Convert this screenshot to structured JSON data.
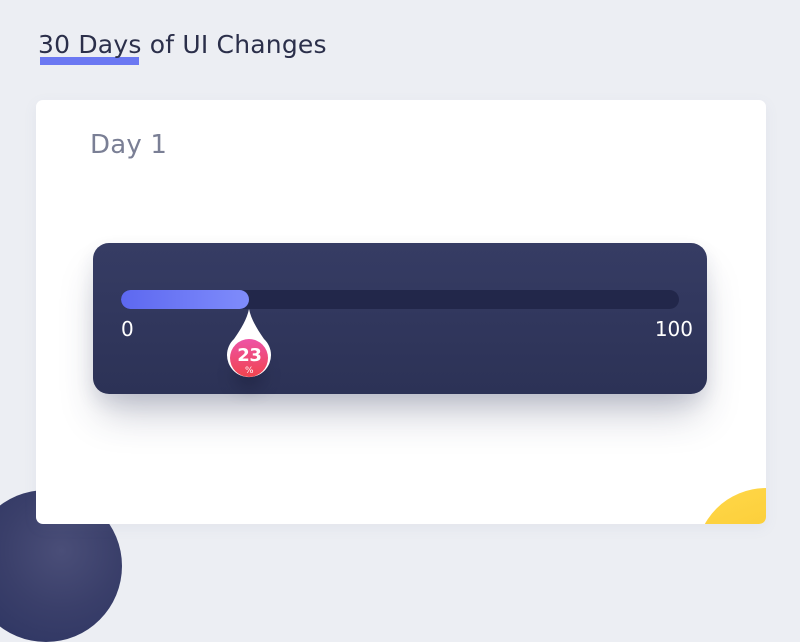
{
  "page": {
    "title": "30 Days of UI Changes"
  },
  "card": {
    "day_label": "Day 1"
  },
  "slider": {
    "value": 23,
    "unit": "%",
    "min": 0,
    "max": 100,
    "min_label": "0",
    "max_label": "100",
    "value_label": "23"
  },
  "colors": {
    "background": "#eceef3",
    "card": "#ffffff",
    "panel": "#323860",
    "track": "#22274a",
    "fill_start": "#5d68f0",
    "fill_end": "#7f8cfb",
    "thumb_top": "#ee53a6",
    "thumb_bottom": "#f0444e",
    "accent_yellow": "#f6bd1c",
    "underline": "#6b78f2"
  },
  "icons": {
    "value_bubble": "droplet-pin-icon"
  }
}
